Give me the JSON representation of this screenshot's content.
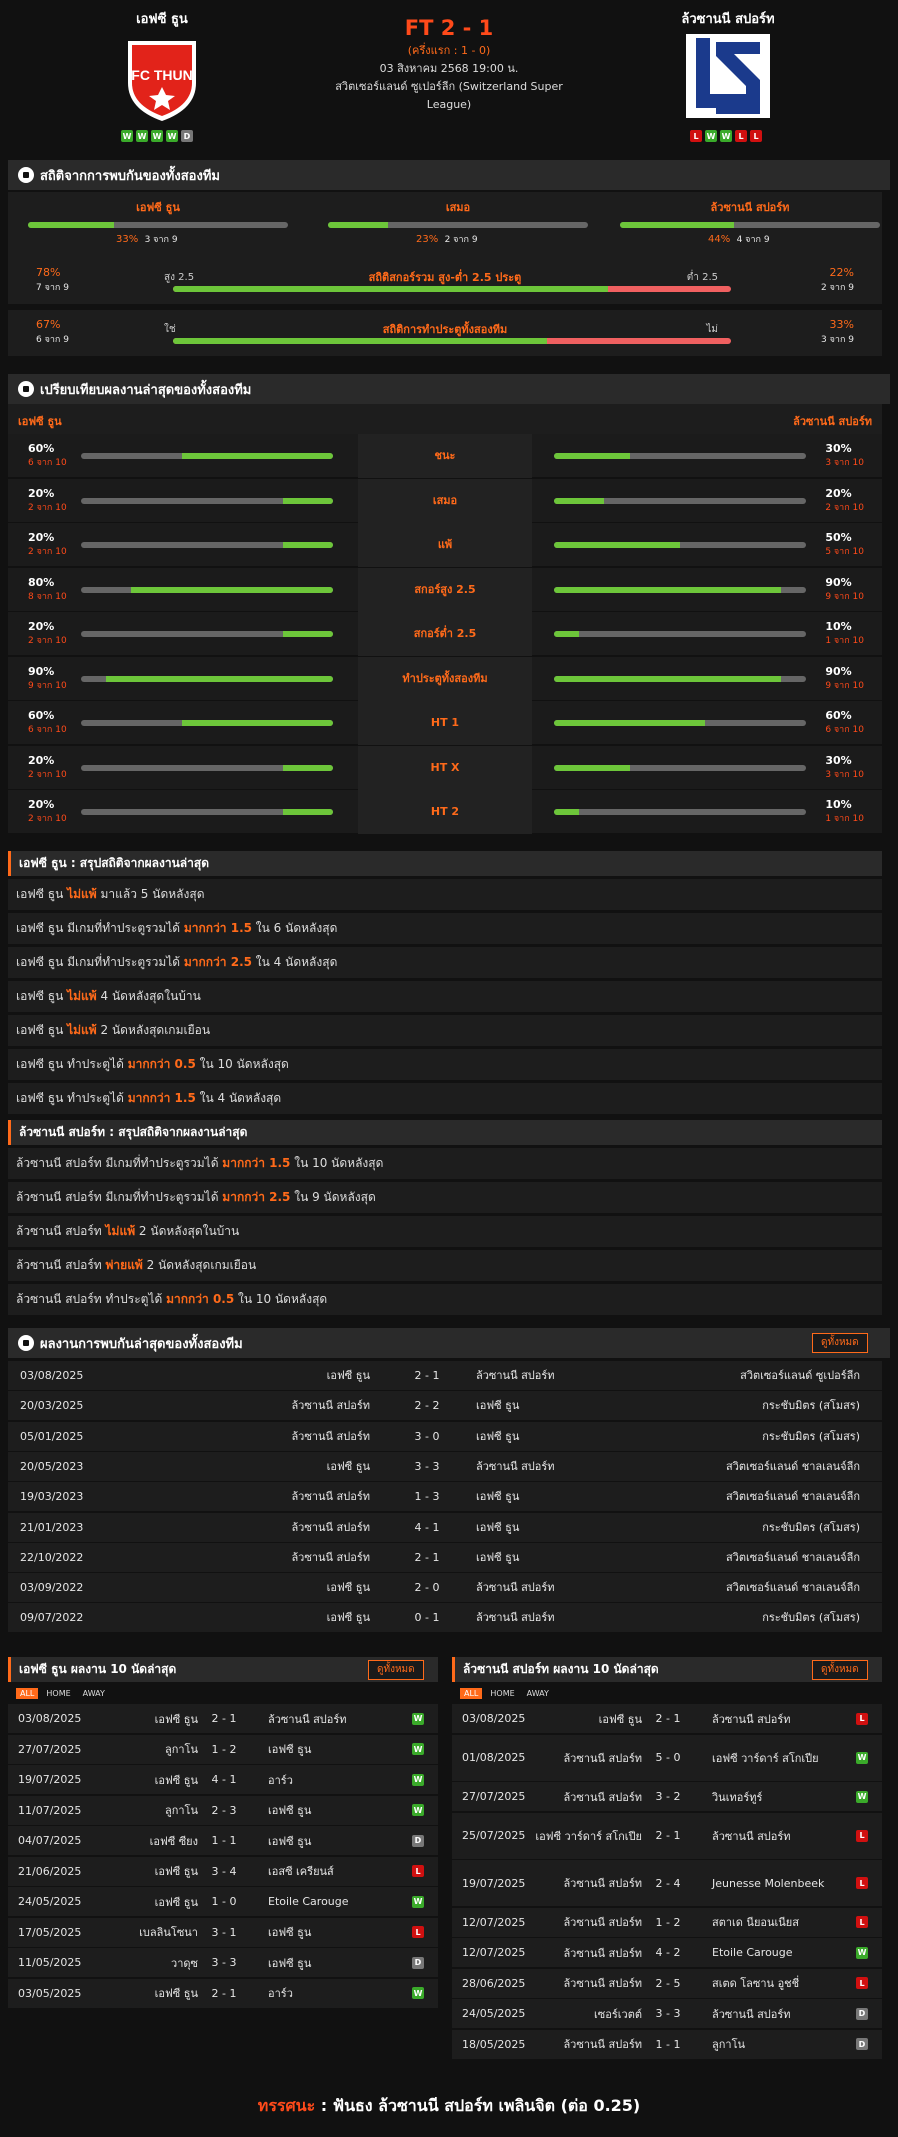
{
  "header": {
    "home": "เอฟซี ธูน",
    "away": "ล้วซานนี สปอร์ท",
    "score": "FT 2 - 1",
    "ht": "(ครึ่งแรก : 1 - 0)",
    "date": "03 สิงหาคม 2568 19:00 น.",
    "league": "สวิตเซอร์แลนด์ ซูเปอร์ลีก (Switzerland Super League)",
    "home_logo_text": "FC THUN",
    "home_form": [
      "W",
      "W",
      "W",
      "W",
      "D"
    ],
    "away_form": [
      "L",
      "W",
      "W",
      "L",
      "L"
    ]
  },
  "h2h_stats": {
    "title": "สถิติจากการพบกันของทั้งสองทีม",
    "cols": [
      {
        "label": "เอฟซี ธูน",
        "pct": "33%",
        "of": "3 จาก 9",
        "v": 0.33
      },
      {
        "label": "เสมอ",
        "pct": "23%",
        "of": "2 จาก 9",
        "v": 0.23
      },
      {
        "label": "ล้วซานนี สปอร์ท",
        "pct": "44%",
        "of": "4 จาก 9",
        "v": 0.44
      }
    ],
    "ou": {
      "lpct": "78%",
      "lof": "7 จาก 9",
      "label": "สถิติสกอร์รวม สูง-ต่ำ 2.5 ประตู",
      "lo": "สูง 2.5",
      "hi": "ต่ำ 2.5",
      "rpct": "22%",
      "rof": "2 จาก 9",
      "v": 0.78
    },
    "btts": {
      "lpct": "67%",
      "lof": "6 จาก 9",
      "label": "สถิติการทำประตูทั้งสองทีม",
      "lo": "ใช่",
      "hi": "ไม่",
      "rpct": "33%",
      "rof": "3 จาก 9",
      "v": 0.67
    }
  },
  "compare": {
    "title": "เปรียบเทียบผลงานล่าสุดของทั้งสองทีม",
    "home": "เอฟซี ธูน",
    "away": "ล้วซานนี สปอร์ท",
    "rows": [
      {
        "label": "ชนะ",
        "lp": "60%",
        "lof": "6 จาก 10",
        "lv": 0.6,
        "rp": "30%",
        "rof": "3 จาก 10",
        "rv": 0.3
      },
      {
        "label": "เสมอ",
        "lp": "20%",
        "lof": "2 จาก 10",
        "lv": 0.2,
        "rp": "20%",
        "rof": "2 จาก 10",
        "rv": 0.2
      },
      {
        "label": "แพ้",
        "lp": "20%",
        "lof": "2 จาก 10",
        "lv": 0.2,
        "rp": "50%",
        "rof": "5 จาก 10",
        "rv": 0.5
      },
      {
        "label": "สกอร์สูง 2.5",
        "lp": "80%",
        "lof": "8 จาก 10",
        "lv": 0.8,
        "rp": "90%",
        "rof": "9 จาก 10",
        "rv": 0.9
      },
      {
        "label": "สกอร์ต่ำ 2.5",
        "lp": "20%",
        "lof": "2 จาก 10",
        "lv": 0.2,
        "rp": "10%",
        "rof": "1 จาก 10",
        "rv": 0.1
      },
      {
        "label": "ทำประตูทั้งสองทีม",
        "lp": "90%",
        "lof": "9 จาก 10",
        "lv": 0.9,
        "rp": "90%",
        "rof": "9 จาก 10",
        "rv": 0.9
      },
      {
        "label": "HT 1",
        "lp": "60%",
        "lof": "6 จาก 10",
        "lv": 0.6,
        "rp": "60%",
        "rof": "6 จาก 10",
        "rv": 0.6
      },
      {
        "label": "HT X",
        "lp": "20%",
        "lof": "2 จาก 10",
        "lv": 0.2,
        "rp": "30%",
        "rof": "3 จาก 10",
        "rv": 0.3
      },
      {
        "label": "HT 2",
        "lp": "20%",
        "lof": "2 จาก 10",
        "lv": 0.2,
        "rp": "10%",
        "rof": "1 จาก 10",
        "rv": 0.1
      }
    ]
  },
  "home_summary": {
    "title": "เอฟซี ธูน : สรุปสถิติจากผลงานล่าสุด",
    "rows": [
      [
        "เอฟซี ธูน ",
        "ไม่แพ้",
        " มาแล้ว 5 นัดหลังสุด"
      ],
      [
        "เอฟซี ธูน มีเกมที่ทำประตูรวมได้ ",
        "มากกว่า 1.5",
        " ใน 6 นัดหลังสุด"
      ],
      [
        "เอฟซี ธูน มีเกมที่ทำประตูรวมได้ ",
        "มากกว่า 2.5",
        " ใน 4 นัดหลังสุด"
      ],
      [
        "เอฟซี ธูน ",
        "ไม่แพ้",
        " 4 นัดหลังสุดในบ้าน"
      ],
      [
        "เอฟซี ธูน ",
        "ไม่แพ้",
        " 2 นัดหลังสุดเกมเยือน"
      ],
      [
        "เอฟซี ธูน ทำประตูได้ ",
        "มากกว่า 0.5",
        " ใน 10 นัดหลังสุด"
      ],
      [
        "เอฟซี ธูน ทำประตูได้ ",
        "มากกว่า 1.5",
        " ใน 4 นัดหลังสุด"
      ]
    ]
  },
  "away_summary": {
    "title": "ล้วซานนี สปอร์ท : สรุปสถิติจากผลงานล่าสุด",
    "rows": [
      [
        "ล้วซานนี สปอร์ท มีเกมที่ทำประตูรวมได้ ",
        "มากกว่า 1.5",
        " ใน 10 นัดหลังสุด"
      ],
      [
        "ล้วซานนี สปอร์ท มีเกมที่ทำประตูรวมได้ ",
        "มากกว่า 2.5",
        " ใน 9 นัดหลังสุด"
      ],
      [
        "ล้วซานนี สปอร์ท ",
        "ไม่แพ้",
        " 2 นัดหลังสุดในบ้าน"
      ],
      [
        "ล้วซานนี สปอร์ท ",
        "พ่ายแพ้",
        " 2 นัดหลังสุดเกมเยือน"
      ],
      [
        "ล้วซานนี สปอร์ท ทำประตูได้ ",
        "มากกว่า 0.5",
        " ใน 10 นัดหลังสุด"
      ]
    ]
  },
  "h2h_results": {
    "title": "ผลงานการพบกันล่าสุดของทั้งสองทีม",
    "view_all": "ดูทั้งหมด",
    "rows": [
      [
        "03/08/2025",
        "เอฟซี ธูน",
        "2 - 1",
        "ล้วซานนี สปอร์ท",
        "สวิตเซอร์แลนด์ ซูเปอร์ลีก"
      ],
      [
        "20/03/2025",
        "ล้วซานนี สปอร์ท",
        "2 - 2",
        "เอฟซี ธูน",
        "กระชับมิตร (สโมสร)"
      ],
      [
        "05/01/2025",
        "ล้วซานนี สปอร์ท",
        "3 - 0",
        "เอฟซี ธูน",
        "กระชับมิตร (สโมสร)"
      ],
      [
        "20/05/2023",
        "เอฟซี ธูน",
        "3 - 3",
        "ล้วซานนี สปอร์ท",
        "สวิตเซอร์แลนด์ ชาลเลนจ์ลีก"
      ],
      [
        "19/03/2023",
        "ล้วซานนี สปอร์ท",
        "1 - 3",
        "เอฟซี ธูน",
        "สวิตเซอร์แลนด์ ชาลเลนจ์ลีก"
      ],
      [
        "21/01/2023",
        "ล้วซานนี สปอร์ท",
        "4 - 1",
        "เอฟซี ธูน",
        "กระชับมิตร (สโมสร)"
      ],
      [
        "22/10/2022",
        "ล้วซานนี สปอร์ท",
        "2 - 1",
        "เอฟซี ธูน",
        "สวิตเซอร์แลนด์ ชาลเลนจ์ลีก"
      ],
      [
        "03/09/2022",
        "เอฟซี ธูน",
        "2 - 0",
        "ล้วซานนี สปอร์ท",
        "สวิตเซอร์แลนด์ ชาลเลนจ์ลีก"
      ],
      [
        "09/07/2022",
        "เอฟซี ธูน",
        "0 - 1",
        "ล้วซานนี สปอร์ท",
        "กระชับมิตร (สโมสร)"
      ]
    ]
  },
  "home_last": {
    "title": "เอฟซี ธูน ผลงาน 10 นัดล่าสุด",
    "view_all": "ดูทั้งหมด",
    "tabs": [
      "ALL",
      "HOME",
      "AWAY"
    ],
    "rows": [
      [
        "03/08/2025",
        "เอฟซี ธูน",
        "2 - 1",
        "ล้วซานนี สปอร์ท",
        "W"
      ],
      [
        "27/07/2025",
        "ลูกาโน",
        "1 - 2",
        "เอฟซี ธูน",
        "W"
      ],
      [
        "19/07/2025",
        "เอฟซี ธูน",
        "4 - 1",
        "อาร์ว",
        "W"
      ],
      [
        "11/07/2025",
        "ลูกาโน",
        "2 - 3",
        "เอฟซี ธูน",
        "W"
      ],
      [
        "04/07/2025",
        "เอฟซี ซียง",
        "1 - 1",
        "เอฟซี ธูน",
        "D"
      ],
      [
        "21/06/2025",
        "เอฟซี ธูน",
        "3 - 4",
        "เอสซี เครียนส์",
        "L"
      ],
      [
        "24/05/2025",
        "เอฟซี ธูน",
        "1 - 0",
        "Etoile Carouge",
        "W"
      ],
      [
        "17/05/2025",
        "เบลลินโซนา",
        "3 - 1",
        "เอฟซี ธูน",
        "L"
      ],
      [
        "11/05/2025",
        "วาดุซ",
        "3 - 3",
        "เอฟซี ธูน",
        "D"
      ],
      [
        "03/05/2025",
        "เอฟซี ธูน",
        "2 - 1",
        "อาร์ว",
        "W"
      ]
    ]
  },
  "away_last": {
    "title": "ล้วซานนี สปอร์ท ผลงาน 10 นัดล่าสุด",
    "view_all": "ดูทั้งหมด",
    "tabs": [
      "ALL",
      "HOME",
      "AWAY"
    ],
    "rows": [
      [
        "03/08/2025",
        "เอฟซี ธูน",
        "2 - 1",
        "ล้วซานนี สปอร์ท",
        "L",
        1
      ],
      [
        "01/08/2025",
        "ล้วซานนี สปอร์ท",
        "5 - 0",
        "เอฟซี วาร์ดาร์ สโกเปีย",
        "W",
        2
      ],
      [
        "27/07/2025",
        "ล้วซานนี สปอร์ท",
        "3 - 2",
        "วินเทอร์ทูร์",
        "W",
        1
      ],
      [
        "25/07/2025",
        "เอฟซี วาร์ดาร์ สโกเปีย",
        "2 - 1",
        "ล้วซานนี สปอร์ท",
        "L",
        2
      ],
      [
        "19/07/2025",
        "ล้วซานนี สปอร์ท",
        "2 - 4",
        "Jeunesse Molenbeek",
        "L",
        2
      ],
      [
        "12/07/2025",
        "ล้วซานนี สปอร์ท",
        "1 - 2",
        "สตาเด นียอนเนียส",
        "L",
        1
      ],
      [
        "12/07/2025",
        "ล้วซานนี สปอร์ท",
        "4 - 2",
        "Etoile Carouge",
        "W",
        1
      ],
      [
        "28/06/2025",
        "ล้วซานนี สปอร์ท",
        "2 - 5",
        "สเตด โลซาน อูชชี่",
        "L",
        1
      ],
      [
        "24/05/2025",
        "เซอร์เวตต์",
        "3 - 3",
        "ล้วซานนี สปอร์ท",
        "D",
        1
      ],
      [
        "18/05/2025",
        "ล้วซานนี สปอร์ท",
        "1 - 1",
        "ลูกาโน",
        "D",
        1
      ]
    ]
  },
  "verdict": {
    "label": "ทรรศนะ",
    "sep": " : ",
    "text": "ฟันธง ล้วซานนี สปอร์ท เพลินจิต (ต่อ 0.25)"
  }
}
